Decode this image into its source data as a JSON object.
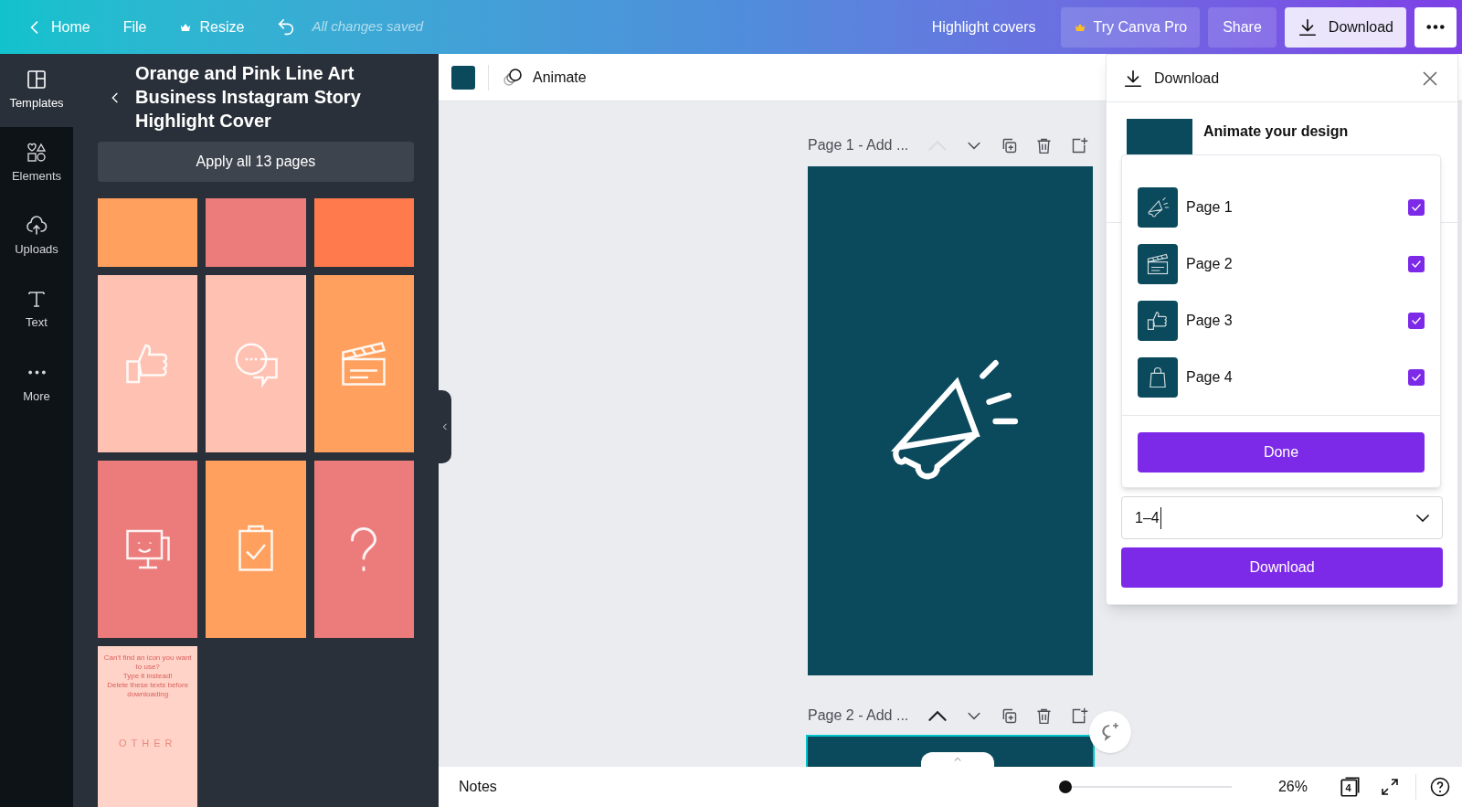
{
  "top_bar": {
    "nav": [
      {
        "kind": "back",
        "label": "Home"
      },
      {
        "kind": "plain",
        "label": "File"
      },
      {
        "kind": "crown",
        "label": "Resize"
      }
    ],
    "save_status": "All changes saved",
    "design_title": "Highlight covers",
    "try_pro": "Try Canva Pro",
    "share": "Share",
    "download": "Download"
  },
  "rail": [
    {
      "kind": "templates",
      "label": "Templates",
      "selected": true
    },
    {
      "kind": "elements",
      "label": "Elements",
      "selected": false
    },
    {
      "kind": "uploads",
      "label": "Uploads",
      "selected": false
    },
    {
      "kind": "text",
      "label": "Text",
      "selected": false
    },
    {
      "kind": "more",
      "label": "More",
      "selected": false
    }
  ],
  "panel": {
    "title": "Orange and Pink Line Art Business Instagram Story Highlight Cover",
    "apply_button": "Apply all 13 pages",
    "templates": [
      {
        "kind": "blank",
        "color": "#ffa05f"
      },
      {
        "kind": "blank",
        "color": "#ec7c7b"
      },
      {
        "kind": "blank",
        "color": "#ff7a4d"
      },
      {
        "kind": "thumbs",
        "color": "#ffc1b1"
      },
      {
        "kind": "chat",
        "color": "#ffc1b1"
      },
      {
        "kind": "clapper",
        "color": "#ffa05f"
      },
      {
        "kind": "monitor",
        "color": "#ec7c7b"
      },
      {
        "kind": "clipboard",
        "color": "#ffa05f"
      },
      {
        "kind": "question",
        "color": "#ec7c7b"
      },
      {
        "kind": "text",
        "color": "#ffd3c7",
        "note": "Can't find an icon you want to use?\nType it instead!\nDelete these texts before downloading",
        "caption": "OTHER"
      }
    ]
  },
  "toolbar": {
    "animate": "Animate"
  },
  "pages": [
    {
      "label": "Page 1 - Add ...",
      "up_disabled": true,
      "selected": false
    },
    {
      "label": "Page 2 - Add ...",
      "up_disabled": false,
      "selected": true
    }
  ],
  "download_panel": {
    "title": "Download",
    "animate_label": "Animate your design",
    "page_options": [
      {
        "kind": "megaphone",
        "label": "Page 1",
        "checked": true
      },
      {
        "kind": "clapper",
        "label": "Page 2",
        "checked": true
      },
      {
        "kind": "thumbs",
        "label": "Page 3",
        "checked": true
      },
      {
        "kind": "bag",
        "label": "Page 4",
        "checked": true
      }
    ],
    "done": "Done",
    "range_value": "1–4",
    "download": "Download"
  },
  "bottom_bar": {
    "notes": "Notes",
    "zoom_slider": {
      "level": 0
    },
    "zoom": "26%",
    "page_count": "4"
  }
}
